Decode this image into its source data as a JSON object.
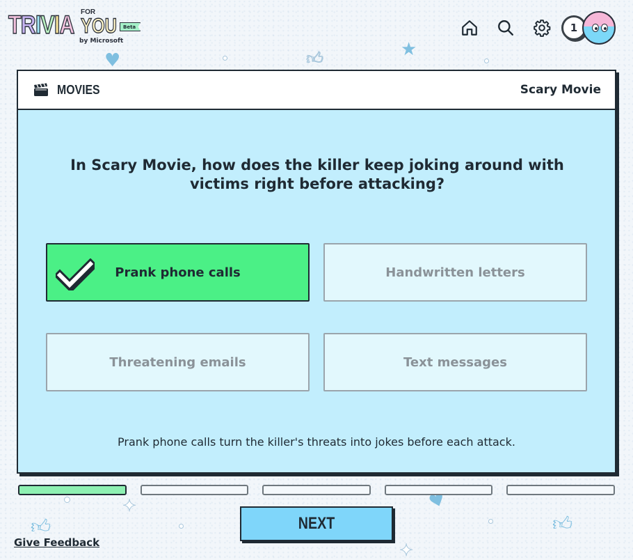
{
  "header": {
    "logo": {
      "letters": [
        "T",
        "R",
        "I",
        "V",
        "I",
        "A"
      ],
      "for": "FOR",
      "you": "YOU",
      "badge": "Beta",
      "byline": "by Microsoft"
    },
    "nav": [
      "home-icon",
      "search-icon",
      "settings-icon"
    ],
    "points": "1",
    "avatar": "avatar"
  },
  "card": {
    "category": "MOVIES",
    "category_icon": "clapperboard-icon",
    "topic": "Scary Movie",
    "question": "In Scary Movie, how does the killer keep joking around with victims right before attacking?",
    "answers": [
      {
        "label": "Prank phone calls",
        "state": "correct"
      },
      {
        "label": "Handwritten letters",
        "state": "disabled"
      },
      {
        "label": "Threatening emails",
        "state": "disabled"
      },
      {
        "label": "Text messages",
        "state": "disabled"
      }
    ],
    "explanation": "Prank phone calls turn the killer's threats into jokes before each attack."
  },
  "progress": {
    "total": 5,
    "completed": 1
  },
  "next_label": "NEXT",
  "feedback_label": "Give Feedback",
  "colors": {
    "card_bg": "#c2eefd",
    "correct": "#4bf086",
    "next_button": "#7fd6fa",
    "progress_done": "#8ef0b2"
  }
}
